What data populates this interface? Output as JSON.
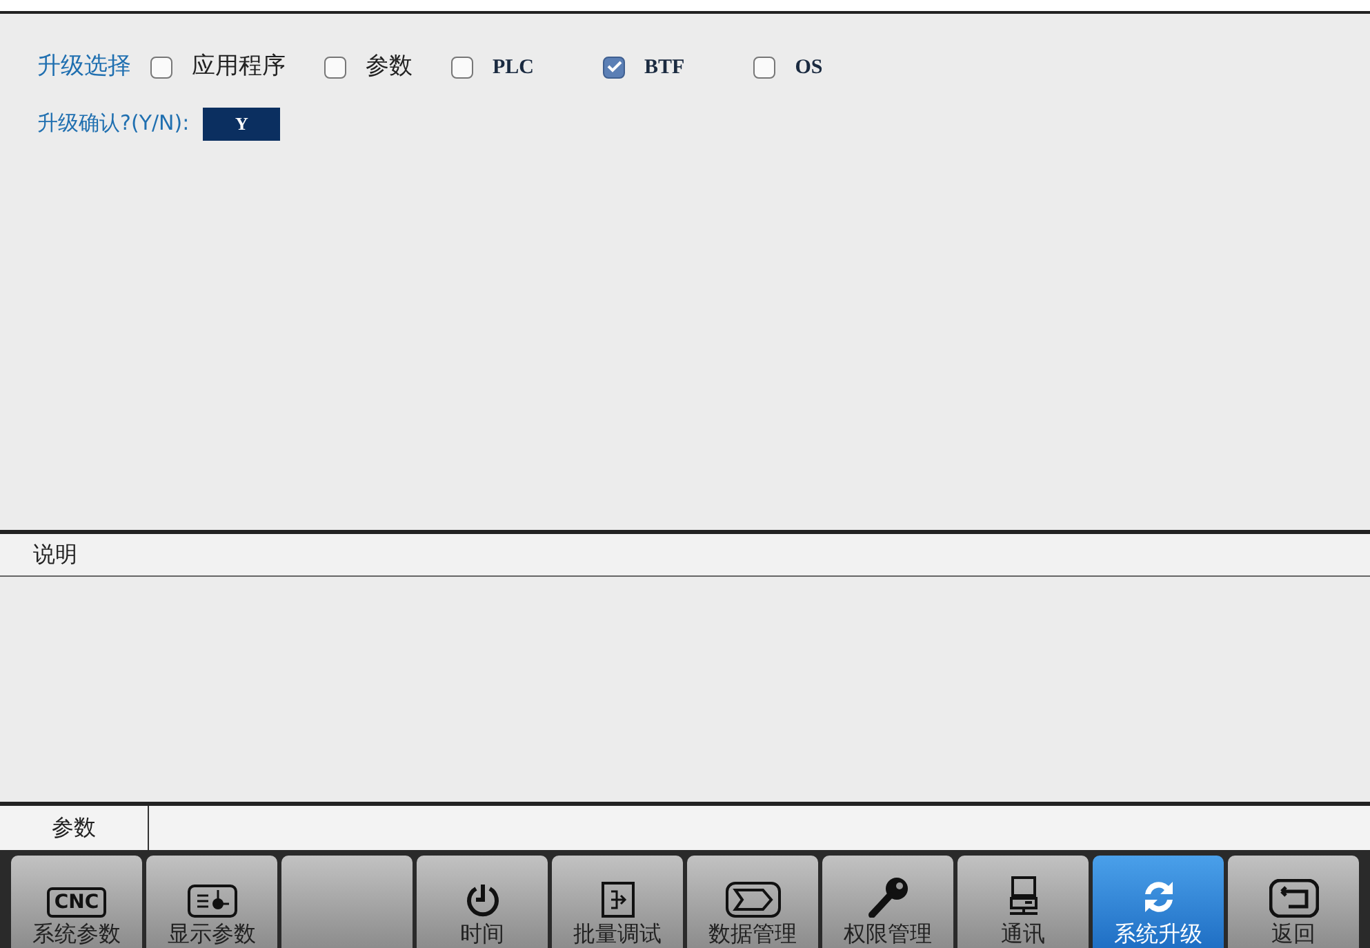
{
  "upgrade_select": {
    "label": "升级选择",
    "options": [
      {
        "label": "应用程序",
        "checked": false,
        "kind": "cjk"
      },
      {
        "label": "参数",
        "checked": false,
        "kind": "cjk"
      },
      {
        "label": "PLC",
        "checked": false,
        "kind": "latin"
      },
      {
        "label": "BTF",
        "checked": true,
        "kind": "latin"
      },
      {
        "label": "OS",
        "checked": false,
        "kind": "latin"
      }
    ]
  },
  "confirm": {
    "label": "升级确认?(Y/N):",
    "value": "Y"
  },
  "description": {
    "title": "说明"
  },
  "status_bar": {
    "label": "参数"
  },
  "softkeys": [
    {
      "kind": "cnc",
      "icon_text": "CNC",
      "label": "系统参数",
      "selected": false
    },
    {
      "kind": "display",
      "label": "显示参数",
      "selected": false
    },
    {
      "kind": "blank",
      "selected": false
    },
    {
      "kind": "clock",
      "label": "时间",
      "selected": false
    },
    {
      "kind": "batch",
      "label": "批量调试",
      "selected": false
    },
    {
      "kind": "data",
      "label": "数据管理",
      "selected": false
    },
    {
      "kind": "key",
      "label": "权限管理",
      "selected": false
    },
    {
      "kind": "network",
      "label": "通讯",
      "selected": false
    },
    {
      "kind": "sync",
      "label": "系统升级",
      "selected": true
    },
    {
      "kind": "return",
      "label": "返回",
      "selected": false
    }
  ]
}
